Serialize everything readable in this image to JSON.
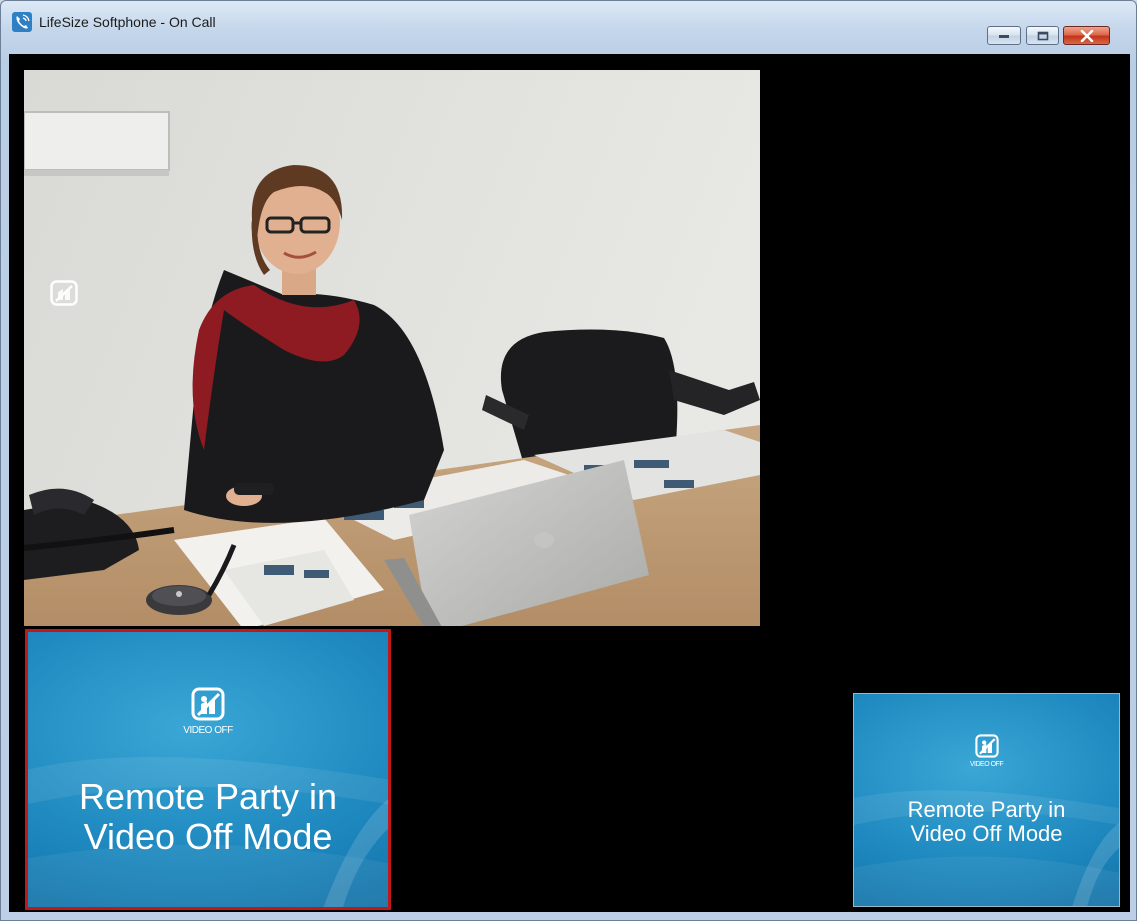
{
  "window": {
    "title": "LifeSize Softphone - On Call",
    "app_icon": "phone-icon"
  },
  "controls": {
    "minimize_icon": "minimize-icon",
    "maximize_icon": "maximize-icon",
    "close_icon": "close-icon"
  },
  "main_video": {
    "overlay_icon": "hide-video-icon"
  },
  "remote_tile": {
    "icon": "video-off-icon",
    "label": "VIDEO OFF",
    "message_line1": "Remote Party in",
    "message_line2": "Video Off Mode"
  },
  "self_tile": {
    "icon": "video-off-icon",
    "label": "VIDEO OFF",
    "message_line1": "Remote Party in",
    "message_line2": "Video Off Mode"
  },
  "colors": {
    "active_border": "#c11919",
    "tile_blue": "#1c86bd",
    "close_red": "#c4331a"
  }
}
